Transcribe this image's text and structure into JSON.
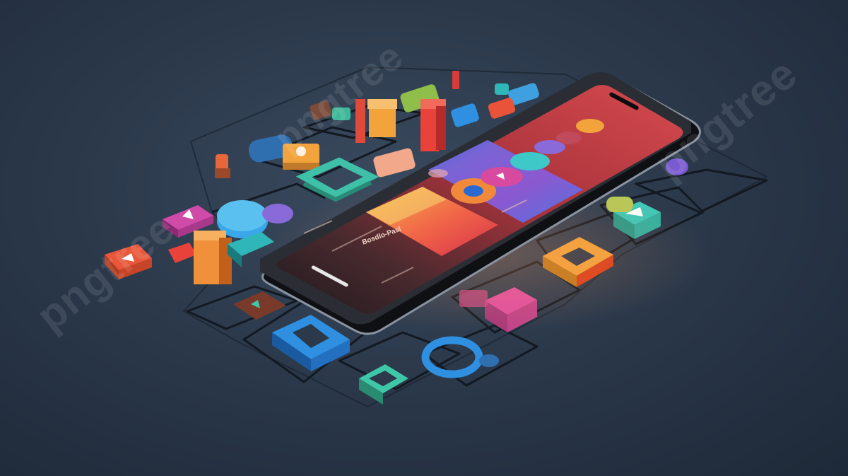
{
  "scene": {
    "subject": "smartphone with floating app icons",
    "colors": {
      "background": "#2b394b",
      "phone_body": "#1a1d22",
      "screen_top": "#c13a42",
      "screen_bottom": "#2a2226",
      "grid_line": "#121922",
      "orange": "#e8673a",
      "yellow": "#f2a33b",
      "pink": "#e0508a",
      "magenta": "#b64ca0",
      "blue": "#2f8fe0",
      "cyan": "#2fb6b8",
      "teal": "#3fb89a",
      "purple": "#7a5ad0"
    }
  },
  "screen": {
    "title": "Bosdlo-Pasl"
  },
  "watermark": {
    "text": "pngtree"
  }
}
